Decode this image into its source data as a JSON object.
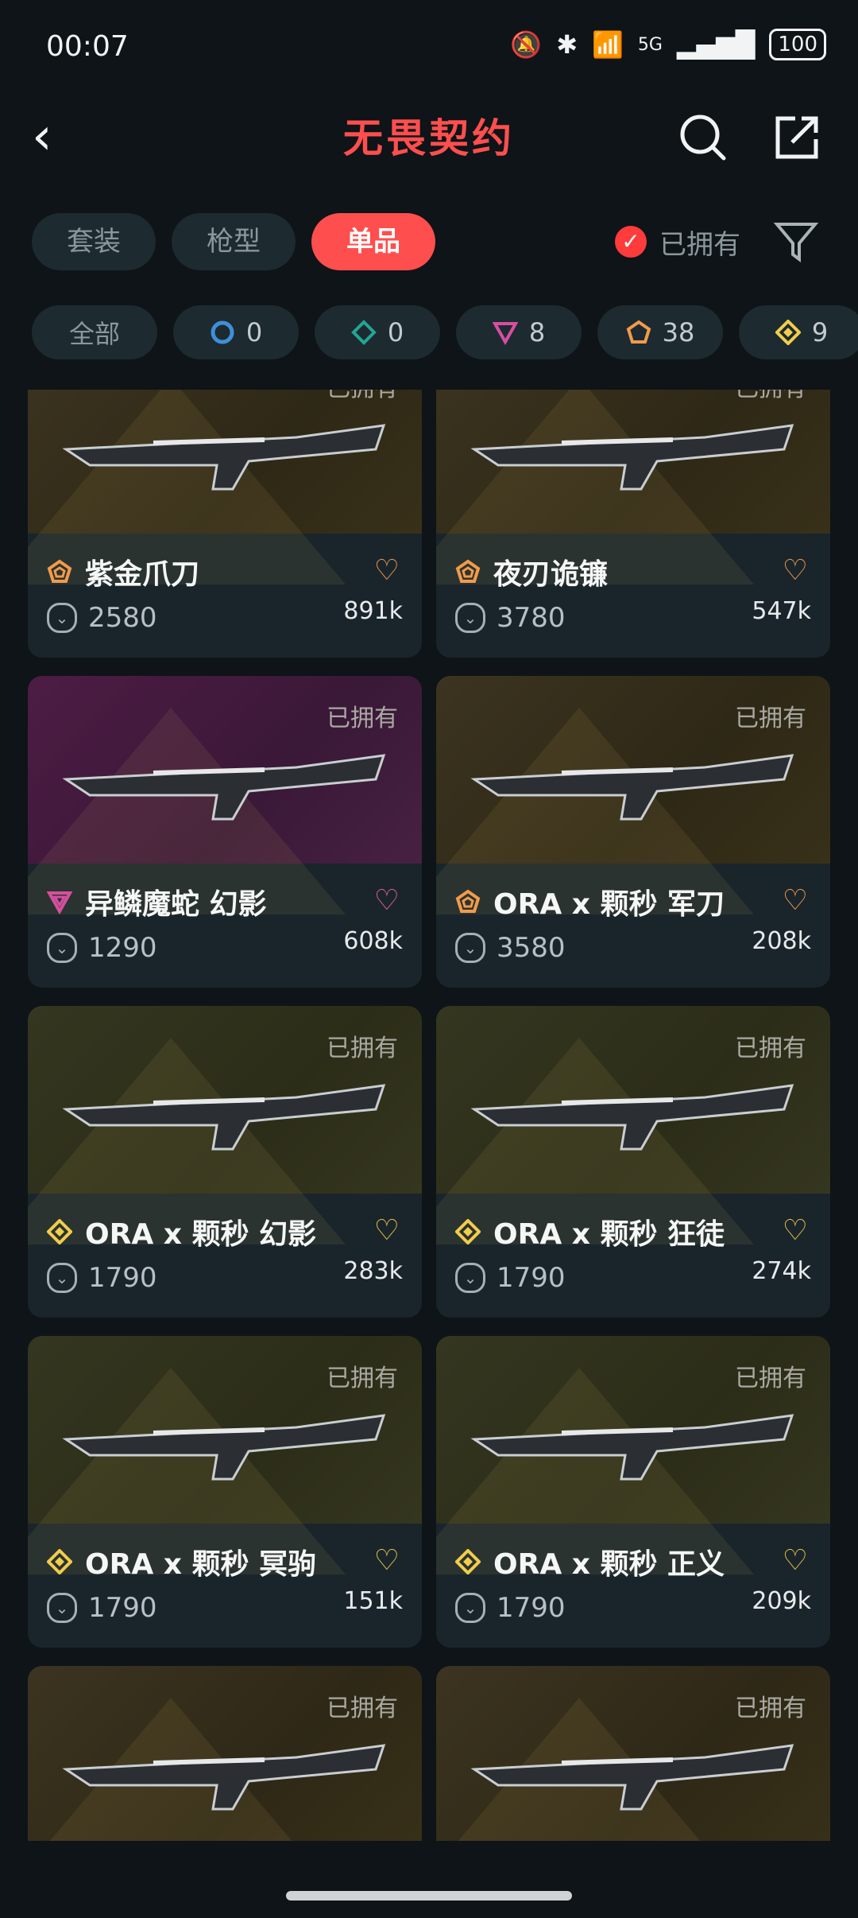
{
  "status": {
    "time": "00:07",
    "network": "5G",
    "battery": "100"
  },
  "header": {
    "title": "无畏契约"
  },
  "tabs": [
    {
      "label": "套装",
      "active": false
    },
    {
      "label": "枪型",
      "active": false
    },
    {
      "label": "单品",
      "active": true
    }
  ],
  "owned_filter": {
    "label": "已拥有",
    "checked": true
  },
  "chips": [
    {
      "label": "全部"
    },
    {
      "count": "0",
      "rarity": "select-blue"
    },
    {
      "count": "0",
      "rarity": "deluxe-teal"
    },
    {
      "count": "8",
      "rarity": "premium-pink"
    },
    {
      "count": "38",
      "rarity": "exclusive-orange"
    },
    {
      "count": "9",
      "rarity": "ultra-yellow"
    }
  ],
  "cards": [
    {
      "name": "紫金爪刀",
      "price": "2580",
      "likes": "891k",
      "owned": "已拥有",
      "rarity": "exclusive-orange",
      "bg": "gold",
      "heart_color": "#f29b4b"
    },
    {
      "name": "夜刃诡镰",
      "price": "3780",
      "likes": "547k",
      "owned": "已拥有",
      "rarity": "exclusive-orange",
      "bg": "gold",
      "heart_color": "#f29b4b"
    },
    {
      "name": "异鳞魔蛇 幻影",
      "price": "1290",
      "likes": "608k",
      "owned": "已拥有",
      "rarity": "premium-pink",
      "bg": "purple",
      "heart_color": "#e0609d"
    },
    {
      "name": "ORA x 颗秒 军刀",
      "price": "3580",
      "likes": "208k",
      "owned": "已拥有",
      "rarity": "exclusive-orange",
      "bg": "gold",
      "heart_color": "#f29b4b"
    },
    {
      "name": "ORA x 颗秒 幻影",
      "price": "1790",
      "likes": "283k",
      "owned": "已拥有",
      "rarity": "ultra-yellow",
      "bg": "olive",
      "heart_color": "#e8c64a"
    },
    {
      "name": "ORA x 颗秒 狂徒",
      "price": "1790",
      "likes": "274k",
      "owned": "已拥有",
      "rarity": "ultra-yellow",
      "bg": "olive",
      "heart_color": "#e8c64a"
    },
    {
      "name": "ORA x 颗秒 冥驹",
      "price": "1790",
      "likes": "151k",
      "owned": "已拥有",
      "rarity": "ultra-yellow",
      "bg": "olive",
      "heart_color": "#e8c64a"
    },
    {
      "name": "ORA x 颗秒 正义",
      "price": "1790",
      "likes": "209k",
      "owned": "已拥有",
      "rarity": "ultra-yellow",
      "bg": "olive",
      "heart_color": "#e8c64a"
    },
    {
      "name": "",
      "price": "",
      "likes": "",
      "owned": "已拥有",
      "rarity": "",
      "bg": "gold",
      "heart_color": ""
    },
    {
      "name": "",
      "price": "",
      "likes": "",
      "owned": "已拥有",
      "rarity": "",
      "bg": "gold",
      "heart_color": ""
    }
  ],
  "colors": {
    "accent": "#ff4e4e",
    "select-blue": "#3f8fd8",
    "deluxe-teal": "#22a597",
    "premium-pink": "#d74fa0",
    "exclusive-orange": "#f29b4b",
    "ultra-yellow": "#f0cd4c"
  }
}
